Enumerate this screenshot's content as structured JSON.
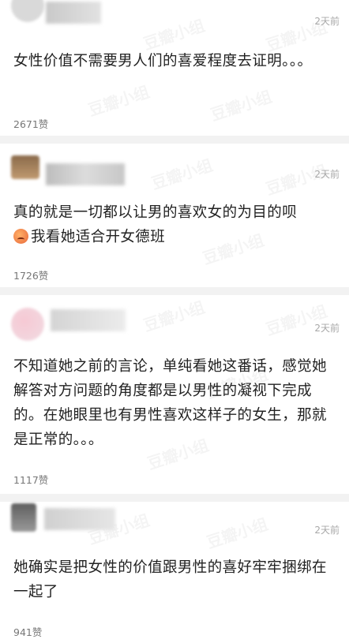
{
  "comments": [
    {
      "time": "2天前",
      "text": "女性价值不需要男人们的喜爱程度去证明。。。",
      "likes": "2671赞"
    },
    {
      "time": "2天前",
      "text": "真的就是一切都以让男的喜欢女的为目的呗",
      "text2": "我看她适合开女德班",
      "emoji": "angry-face-emoji",
      "likes": "1726赞"
    },
    {
      "time": "2天前",
      "text": "不知道她之前的言论，单纯看她这番话，感觉她解答对方问题的角度都是以男性的凝视下完成的。在她眼里也有男性喜欢这样子的女生，那就是正常的。。。",
      "likes": "1117赞"
    },
    {
      "time": "2天前",
      "text": "她确实是把女性的价值跟男性的喜好牢牢捆绑在一起了",
      "likes": "941赞"
    }
  ],
  "watermark": "豆瓣小组"
}
